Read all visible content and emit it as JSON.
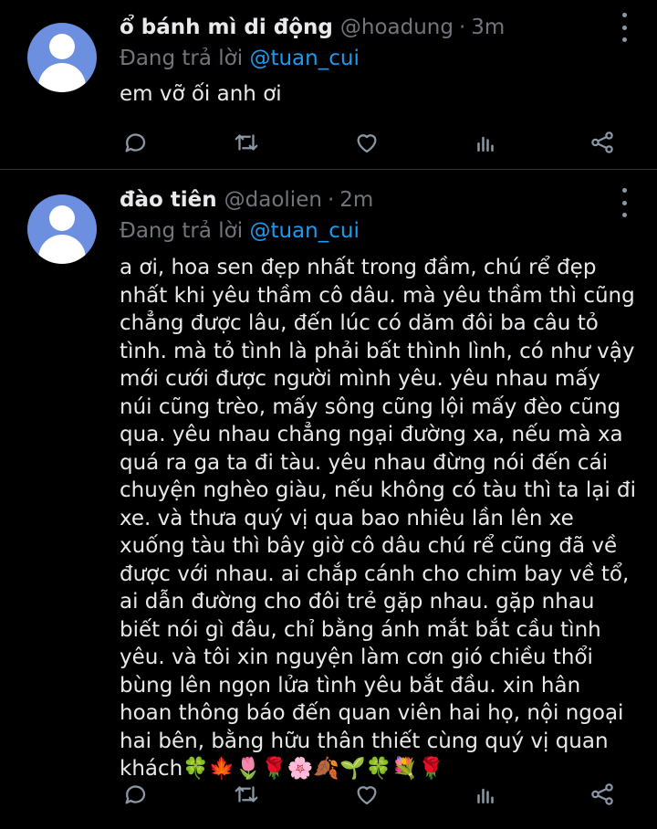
{
  "tweets": [
    {
      "name": "ổ bánh mì di động",
      "handle": "@hoadung",
      "separator": "·",
      "time": "3m",
      "replying_label": "Đang trả lời",
      "reply_to": "@tuan_cui",
      "text": "em vỡ ối anh ơi",
      "more_icon": "more-vertical-icon",
      "actions": [
        "reply-icon",
        "retweet-icon",
        "like-icon",
        "views-icon",
        "share-icon"
      ]
    },
    {
      "name": "đào tiên",
      "handle": "@daolien",
      "separator": "·",
      "time": "2m",
      "replying_label": "Đang trả lời",
      "reply_to": "@tuan_cui",
      "text": "a ơi, hoa sen đẹp nhất trong đầm, chú rể đẹp\nnhất khi yêu thầm cô dâu. mà yêu thầm thì cũng\nchẳng được lâu, đến lúc có dăm đôi ba câu tỏ\ntình. mà tỏ tình là phải bất thình lình, có như vậy\nmới cưới được người mình yêu. yêu nhau mấy\nnúi cũng trèo, mấy sông cũng lội mấy đèo cũng\nqua. yêu nhau chẳng ngại đường xa, nếu mà xa\nquá ra ga ta đi tàu. yêu nhau đừng nói đến cái\nchuyện nghèo giàu, nếu không có tàu thì ta lại đi\nxe. và thưa quý vị qua bao nhiêu lần lên xe\nxuống tàu thì bây giờ cô dâu chú rể cũng đã về\nđược với nhau. ai chắp cánh cho chim bay về tổ,\nai dẫn đường cho đôi trẻ gặp nhau. gặp nhau\nbiết nói gì đâu, chỉ bằng ánh mắt bắt cầu tình\nyêu. và tôi xin nguyện làm cơn gió chiều thổi\nbùng lên ngọn lửa tình yêu bắt đầu. xin hân\nhoan thông báo đến quan viên hai họ, nội ngoại\nhai bên, bằng hữu thân thiết cùng quý vị quan\nkhách🍀🍁🌷🌹🌸🍂🌱🍀💐🌹",
      "more_icon": "more-vertical-icon",
      "actions": [
        "reply-icon",
        "retweet-icon",
        "like-icon",
        "views-icon",
        "share-icon"
      ]
    }
  ],
  "colors": {
    "background": "#000000",
    "text": "#e7e9ea",
    "muted": "#71767b",
    "link": "#1d9bf0",
    "avatar": "#6d8fe0",
    "divider": "#2f3336"
  }
}
